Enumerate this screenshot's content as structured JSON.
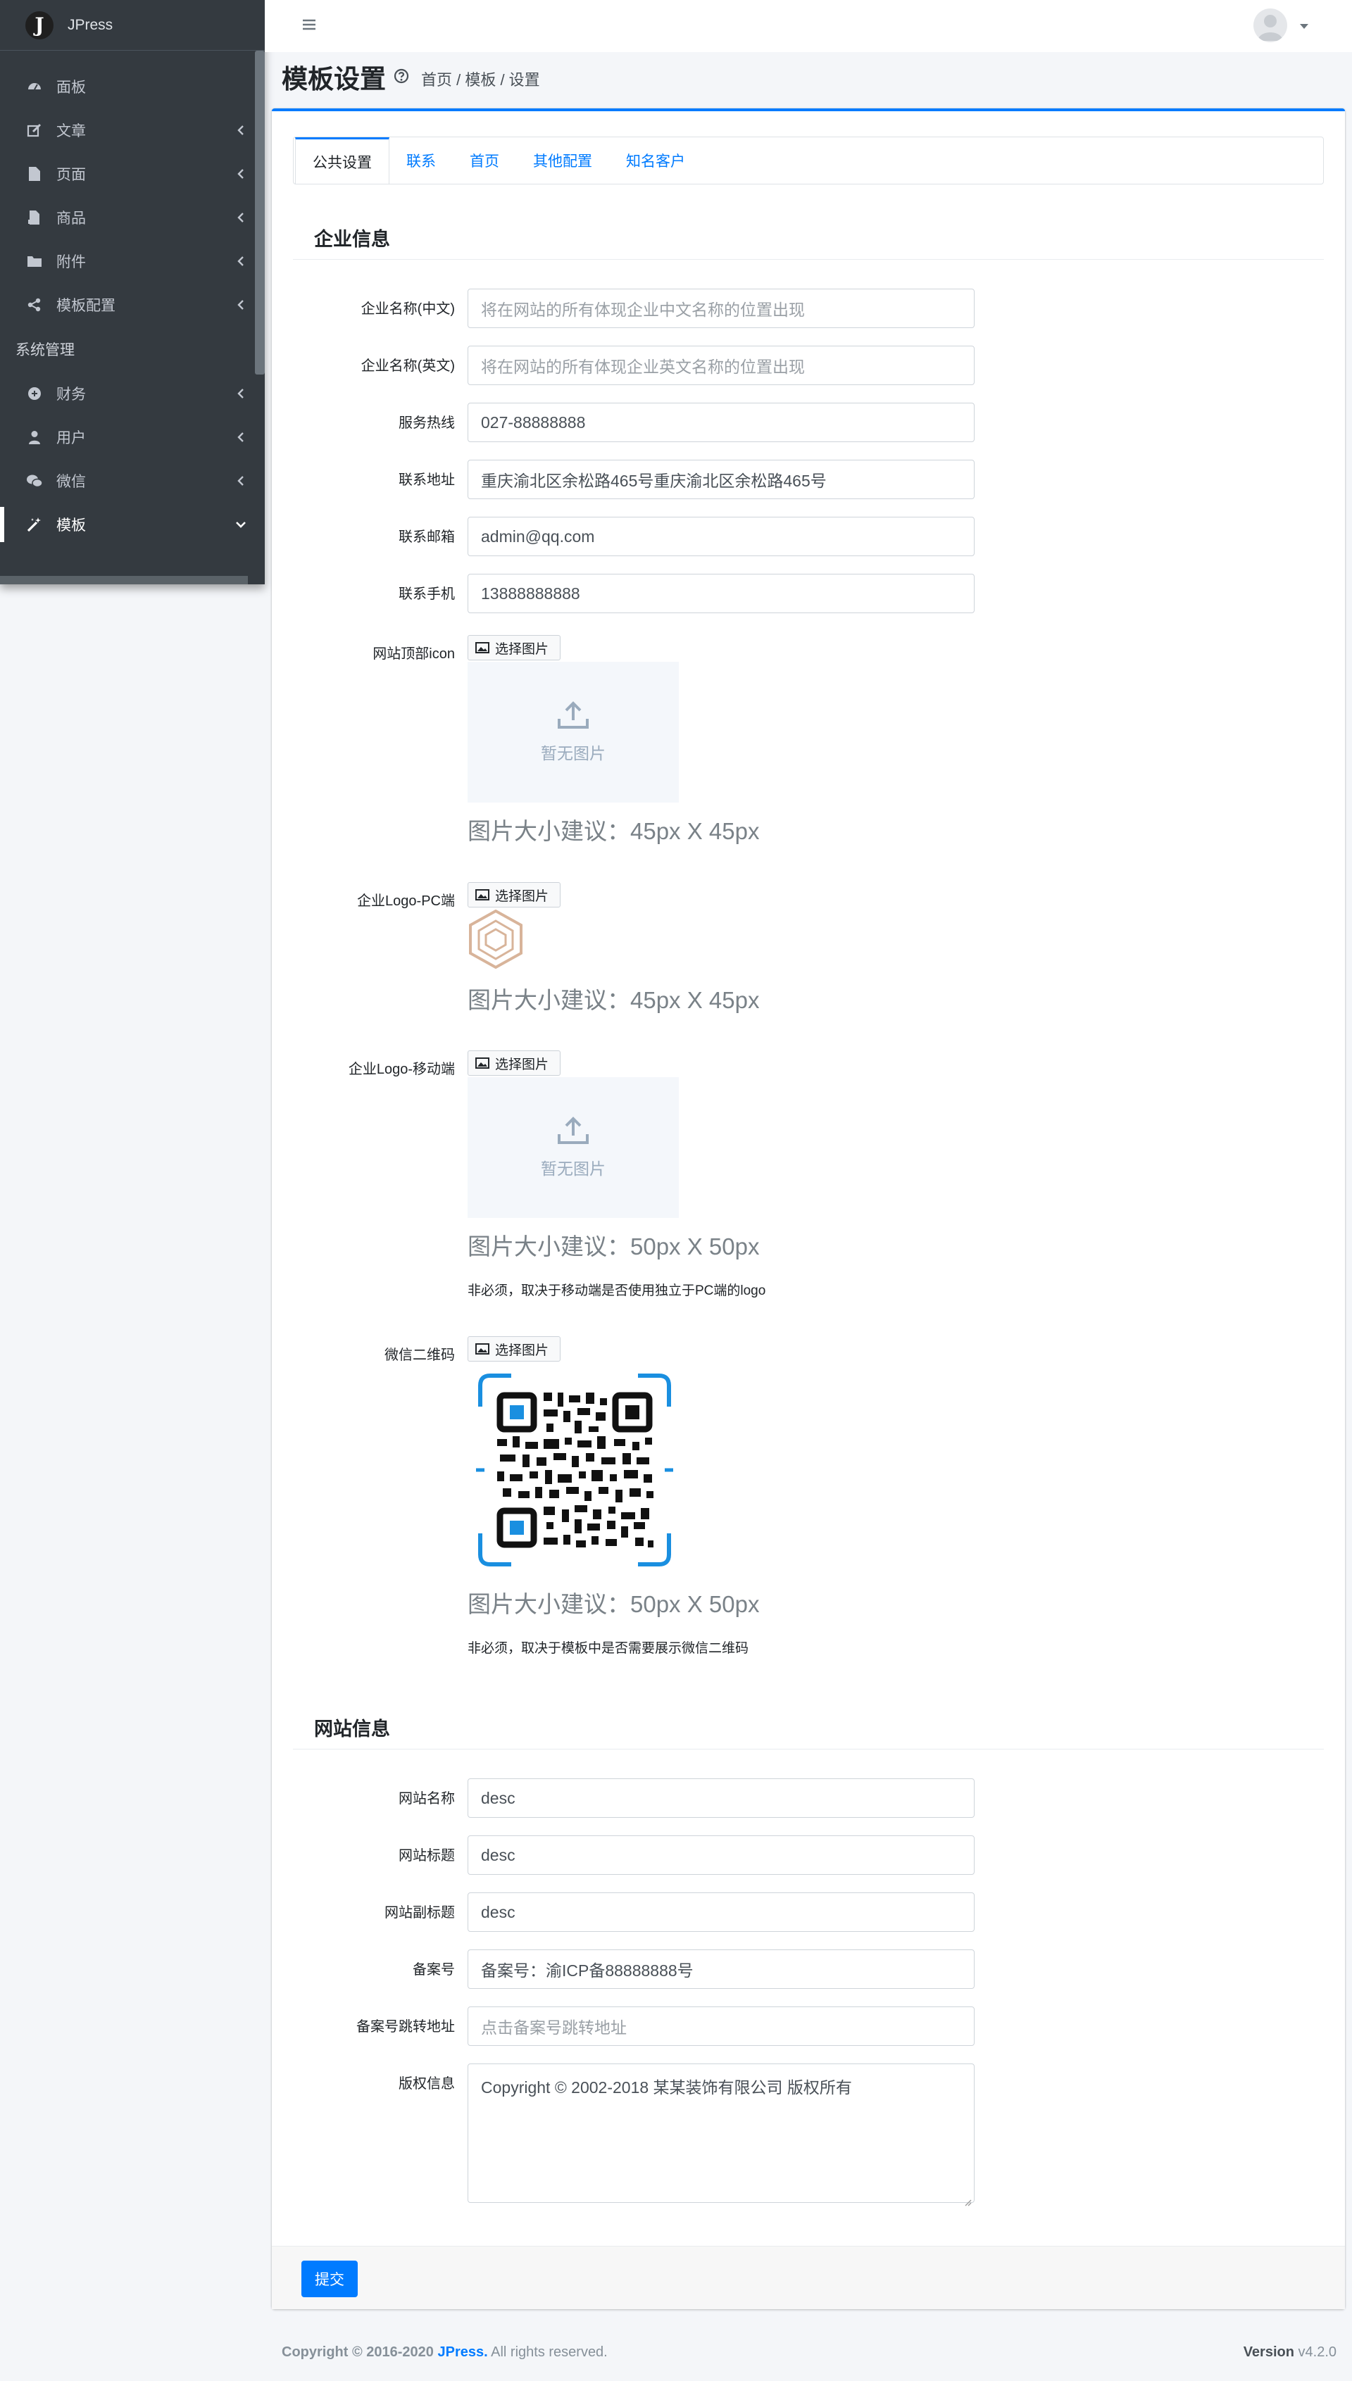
{
  "brand": {
    "name": "JPress",
    "logo_letter": "J"
  },
  "sidebar": {
    "items": [
      {
        "label": "面板",
        "icon": "dashboard-icon",
        "chevron": false
      },
      {
        "label": "文章",
        "icon": "edit-icon",
        "chevron": true
      },
      {
        "label": "页面",
        "icon": "file-icon",
        "chevron": true
      },
      {
        "label": "商品",
        "icon": "product-icon",
        "chevron": true
      },
      {
        "label": "附件",
        "icon": "folder-icon",
        "chevron": true
      },
      {
        "label": "模板配置",
        "icon": "share-icon",
        "chevron": true
      }
    ],
    "header": "系统管理",
    "items2": [
      {
        "label": "财务",
        "icon": "finance-icon",
        "chevron": true
      },
      {
        "label": "用户",
        "icon": "user-icon",
        "chevron": true
      },
      {
        "label": "微信",
        "icon": "wechat-icon",
        "chevron": true
      },
      {
        "label": "模板",
        "icon": "magic-icon",
        "chevron": true,
        "active": true
      }
    ]
  },
  "page": {
    "title": "模板设置",
    "breadcrumb": "首页 / 模板 / 设置"
  },
  "tabs": [
    "公共设置",
    "联系",
    "首页",
    "其他配置",
    "知名客户"
  ],
  "company": {
    "section_title": "企业信息",
    "fields": [
      {
        "label": "企业名称(中文)",
        "value": "",
        "placeholder": "将在网站的所有体现企业中文名称的位置出现"
      },
      {
        "label": "企业名称(英文)",
        "value": "",
        "placeholder": "将在网站的所有体现企业英文名称的位置出现"
      },
      {
        "label": "服务热线",
        "value": "027-88888888"
      },
      {
        "label": "联系地址",
        "value": "重庆渝北区余松路465号重庆渝北区余松路465号"
      },
      {
        "label": "联系邮箱",
        "value": "admin@qq.com"
      },
      {
        "label": "联系手机",
        "value": "13888888888"
      }
    ],
    "pick_label": "选择图片",
    "no_image": "暂无图片",
    "images": [
      {
        "label": "网站顶部icon",
        "hint": "图片大小建议：45px X 45px"
      },
      {
        "label": "企业Logo-PC端",
        "hint": "图片大小建议：45px X 45px"
      },
      {
        "label": "企业Logo-移动端",
        "hint": "图片大小建议：50px X 50px",
        "note": "非必须，取决于移动端是否使用独立于PC端的logo"
      },
      {
        "label": "微信二维码",
        "hint": "图片大小建议：50px X 50px",
        "note": "非必须，取决于模板中是否需要展示微信二维码"
      }
    ]
  },
  "site": {
    "section_title": "网站信息",
    "fields": [
      {
        "label": "网站名称",
        "value": "desc"
      },
      {
        "label": "网站标题",
        "value": "desc"
      },
      {
        "label": "网站副标题",
        "value": "desc"
      },
      {
        "label": "备案号",
        "value": "备案号：渝ICP备88888888号"
      },
      {
        "label": "备案号跳转地址",
        "value": "",
        "placeholder": "点击备案号跳转地址"
      },
      {
        "label": "版权信息",
        "value": "Copyright © 2002-2018 某某装饰有限公司 版权所有"
      }
    ]
  },
  "submit_label": "提交",
  "footer": {
    "copyright_prefix": "Copyright © 2016-2020",
    "brand": "JPress.",
    "rights": "All rights reserved.",
    "version_label": "Version",
    "version": "v4.2.0"
  },
  "colors": {
    "primary": "#007bff",
    "sidebar": "#343a40"
  }
}
